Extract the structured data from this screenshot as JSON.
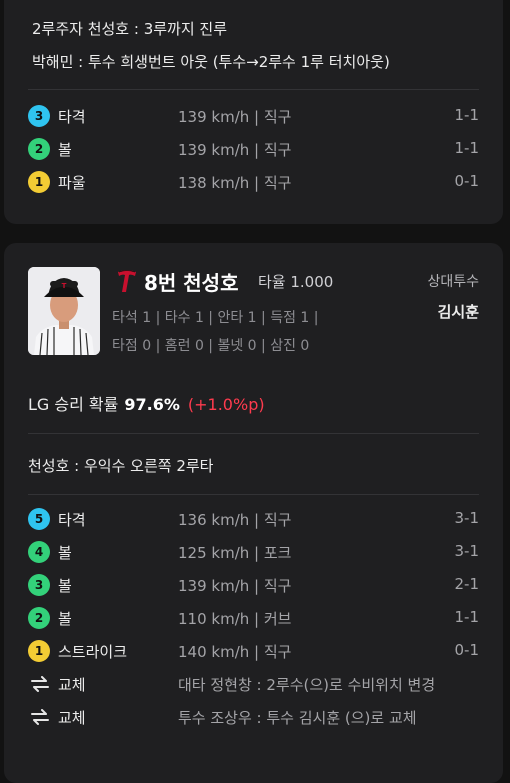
{
  "card1": {
    "events": [
      "2루주자 천성호 : 3루까지 진루",
      "박해민 : 투수 희생번트 아웃 (투수→2루수 1루 터치아웃)"
    ],
    "pitches": [
      {
        "num": "3",
        "result": "타격",
        "speed": "139 km/h | 직구",
        "count": "1-1",
        "type": "hit"
      },
      {
        "num": "2",
        "result": "볼",
        "speed": "139 km/h | 직구",
        "count": "1-1",
        "type": "ball"
      },
      {
        "num": "1",
        "result": "파울",
        "speed": "138 km/h | 직구",
        "count": "0-1",
        "type": "foul"
      }
    ]
  },
  "card2": {
    "batter": {
      "name": "8번 천성호",
      "avg": "타율 1.000",
      "stats_line1": "타석 1 | 타수 1 | 안타 1 | 득점 1 |",
      "stats_line2": "타점 0 | 홈런 0 | 볼넷 0 | 삼진 0",
      "team_logo": "twins-t-logo"
    },
    "opponent": {
      "label": "상대투수",
      "name": "김시훈"
    },
    "win_prob": {
      "label": "LG 승리 확률",
      "value": "97.6%",
      "delta": "(+1.0%p)"
    },
    "result": "천성호 : 우익수 오른쪽 2루타",
    "pitches": [
      {
        "num": "5",
        "result": "타격",
        "speed": "136 km/h | 직구",
        "count": "3-1",
        "type": "hit"
      },
      {
        "num": "4",
        "result": "볼",
        "speed": "125 km/h | 포크",
        "count": "3-1",
        "type": "ball"
      },
      {
        "num": "3",
        "result": "볼",
        "speed": "139 km/h | 직구",
        "count": "2-1",
        "type": "ball"
      },
      {
        "num": "2",
        "result": "볼",
        "speed": "110 km/h | 커브",
        "count": "1-1",
        "type": "ball"
      },
      {
        "num": "1",
        "result": "스트라이크",
        "speed": "140 km/h | 직구",
        "count": "0-1",
        "type": "strike"
      }
    ],
    "substitutions": [
      {
        "label": "교체",
        "text": "대타 정현창 : 2루수(으)로 수비위치 변경",
        "icon": "swap-icon"
      },
      {
        "label": "교체",
        "text": "투수 조상우 : 투수 김시훈 (으)로 교체",
        "icon": "swap-icon"
      }
    ]
  },
  "colors": {
    "hit": "#2fc4f0",
    "ball": "#33d17a",
    "foul": "#f3cc34",
    "strike": "#f3cc34",
    "delta": "#ff3b4e"
  }
}
